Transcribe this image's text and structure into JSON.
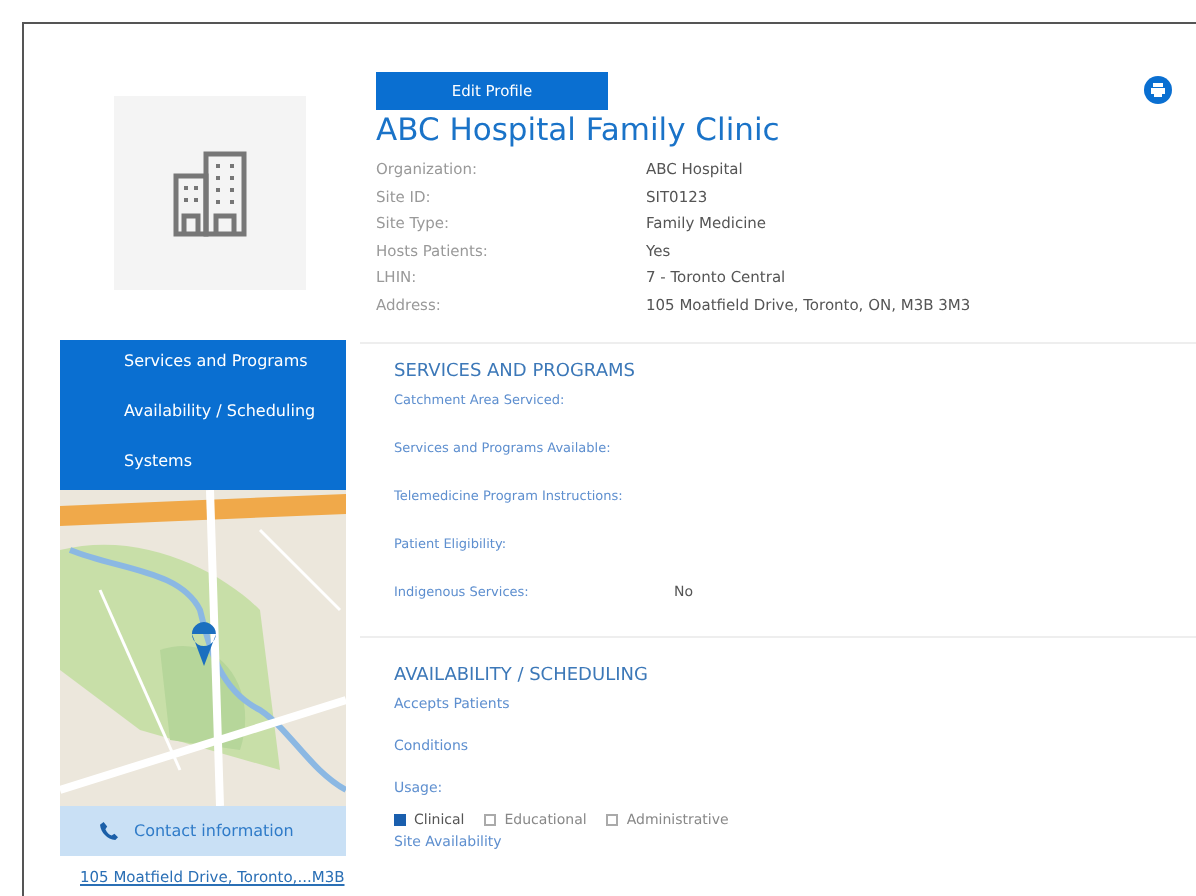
{
  "header": {
    "edit_button": "Edit Profile",
    "title": "ABC Hospital Family Clinic",
    "details": [
      {
        "label": "Organization:",
        "value": "ABC Hospital"
      },
      {
        "label": "Site ID:",
        "value": "SIT0123"
      },
      {
        "label": "Site Type:",
        "value": "Family Medicine"
      },
      {
        "label": "Hosts Patients:",
        "value": "Yes"
      },
      {
        "label": "LHIN:",
        "value": "7 - Toronto Central"
      },
      {
        "label": "Address:",
        "value": "105 Moatfield Drive, Toronto, ON, M3B 3M3"
      }
    ]
  },
  "sidebar": {
    "items": [
      {
        "label": "Services and Programs"
      },
      {
        "label": "Availability / Scheduling"
      },
      {
        "label": "Systems"
      }
    ],
    "contact": "Contact information",
    "address_link": "105 Moatfield Drive, Toronto,...M3B"
  },
  "services": {
    "heading": "SERVICES AND PROGRAMS",
    "fields": [
      {
        "label": "Catchment Area Serviced:"
      },
      {
        "label": "Services and Programs Available:"
      },
      {
        "label": "Telemedicine Program Instructions:"
      },
      {
        "label": "Patient Eligibility:"
      },
      {
        "label": "Indigenous Services:",
        "value": "No"
      }
    ]
  },
  "availability": {
    "heading": "AVAILABILITY / SCHEDULING",
    "fields": [
      {
        "label": "Accepts Patients"
      },
      {
        "label": "Conditions"
      }
    ],
    "usage_label": "Usage:",
    "usage": [
      {
        "label": "Clinical",
        "checked": true
      },
      {
        "label": "Educational",
        "checked": false
      },
      {
        "label": "Administrative",
        "checked": false
      }
    ],
    "site_availability": "Site Availability"
  }
}
